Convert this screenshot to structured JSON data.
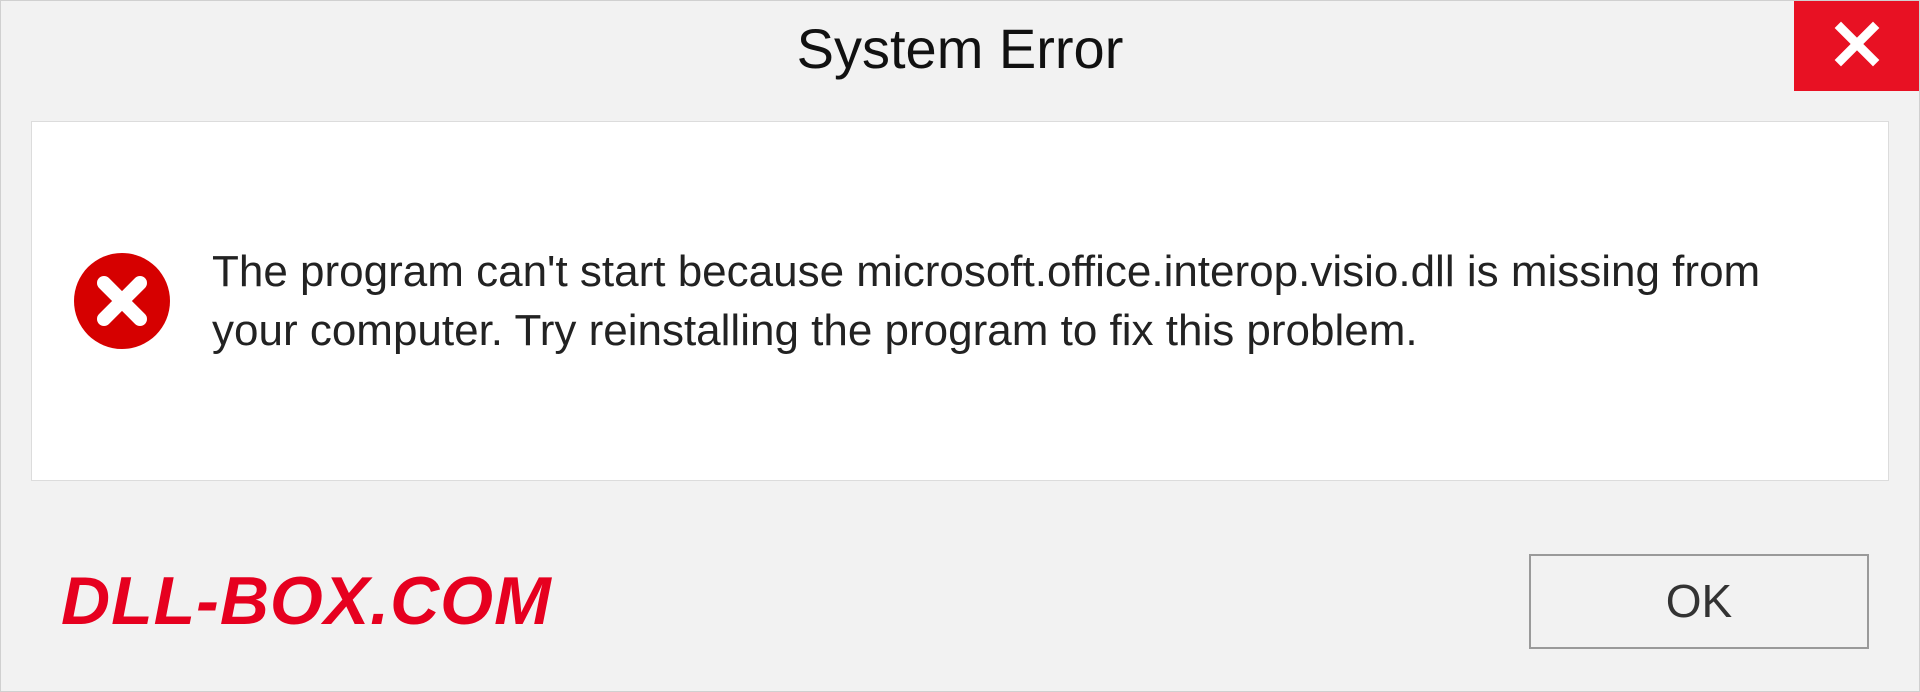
{
  "titlebar": {
    "title": "System Error"
  },
  "content": {
    "message": "The program can't start because microsoft.office.interop.visio.dll is missing from your computer. Try reinstalling the program to fix this problem."
  },
  "footer": {
    "watermark": "DLL-BOX.COM",
    "ok_label": "OK"
  },
  "icons": {
    "close": "close-icon",
    "error": "error-icon"
  },
  "colors": {
    "close_bg": "#e81123",
    "error_fill": "#d60000",
    "watermark": "#e6001f"
  }
}
